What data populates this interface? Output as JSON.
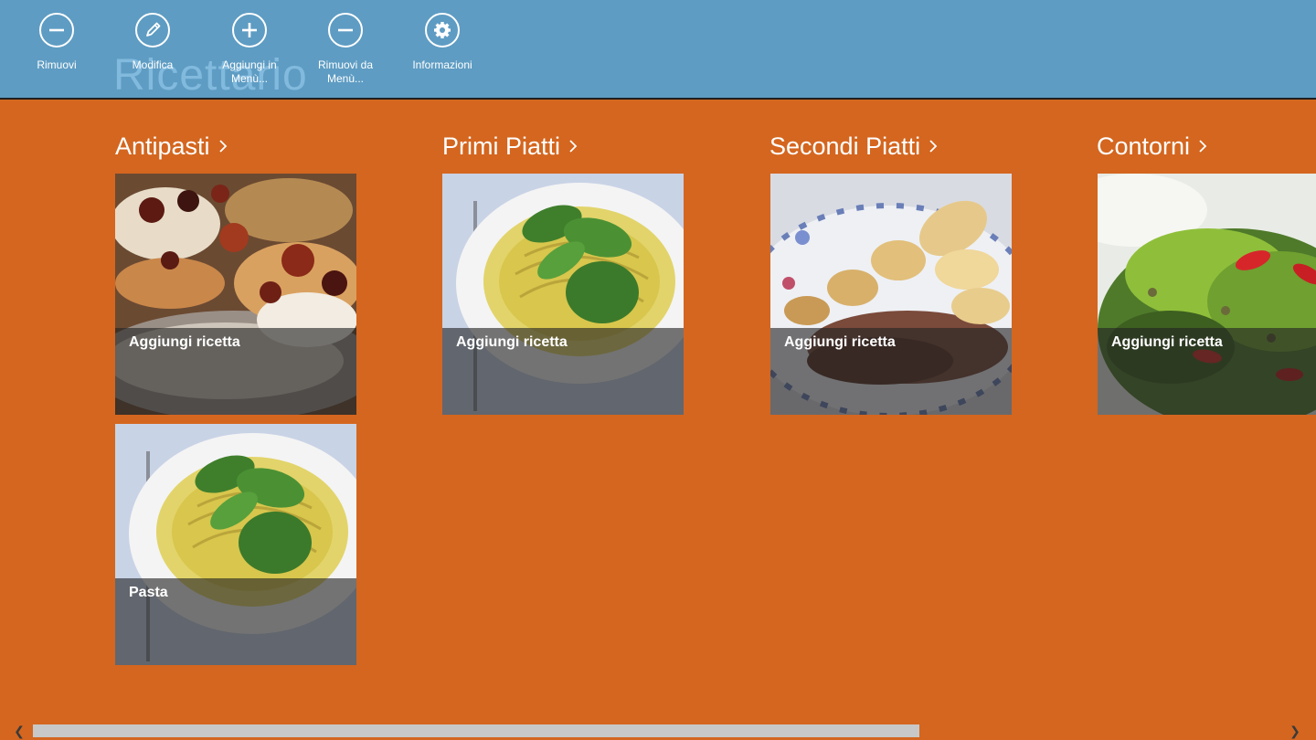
{
  "app": {
    "title": "Ricettario"
  },
  "appbar": {
    "commands": [
      {
        "label": "Rimuovi",
        "icon": "remove-icon"
      },
      {
        "label": "Modifica",
        "icon": "edit-icon"
      },
      {
        "label": "Aggiungi in\nMenù...",
        "icon": "add-icon"
      },
      {
        "label": "Rimuovi da\nMenù...",
        "icon": "remove-icon"
      },
      {
        "label": "Informazioni",
        "icon": "settings-icon"
      }
    ]
  },
  "groups": [
    {
      "title": "Antipasti",
      "tiles": [
        {
          "caption": "Aggiungi ricetta"
        },
        {
          "caption": "Pasta"
        }
      ]
    },
    {
      "title": "Primi Piatti",
      "tiles": [
        {
          "caption": "Aggiungi ricetta"
        }
      ]
    },
    {
      "title": "Secondi Piatti",
      "tiles": [
        {
          "caption": "Aggiungi ricetta"
        }
      ]
    },
    {
      "title": "Contorni",
      "tiles": [
        {
          "caption": "Aggiungi ricetta"
        }
      ]
    }
  ],
  "colors": {
    "background": "#d4661f",
    "appbar": "#5e9cc3",
    "text": "#ffffff"
  }
}
